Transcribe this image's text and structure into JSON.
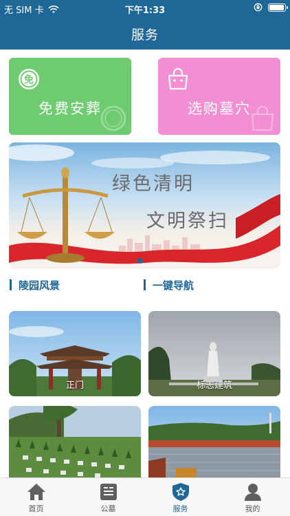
{
  "status_bar": {
    "carrier": "无 SIM 卡",
    "time": "下午1:33",
    "battery_level": 1.0
  },
  "header": {
    "title": "服务"
  },
  "service_cards": [
    {
      "label": "免费安葬",
      "icon": "free-badge-icon",
      "color": "#6fcb6f"
    },
    {
      "label": "选购墓穴",
      "icon": "shopping-bag-icon",
      "color": "#f28fd3"
    }
  ],
  "banner": {
    "line1": "绿色清明",
    "line2": "文明祭扫"
  },
  "sections": {
    "left": "陵园风景",
    "right": "一键导航"
  },
  "photos": [
    {
      "caption": "正门"
    },
    {
      "caption": "标志建筑"
    },
    {
      "caption": ""
    },
    {
      "caption": ""
    }
  ],
  "tabbar": {
    "items": [
      {
        "label": "首页",
        "icon": "home-icon"
      },
      {
        "label": "公墓",
        "icon": "cemetery-card-icon"
      },
      {
        "label": "服务",
        "icon": "service-shield-icon",
        "active": true
      },
      {
        "label": "我的",
        "icon": "user-icon"
      }
    ]
  },
  "colors": {
    "brand": "#1e6796",
    "green_card": "#6fcb6f",
    "pink_card": "#f28fd3"
  }
}
